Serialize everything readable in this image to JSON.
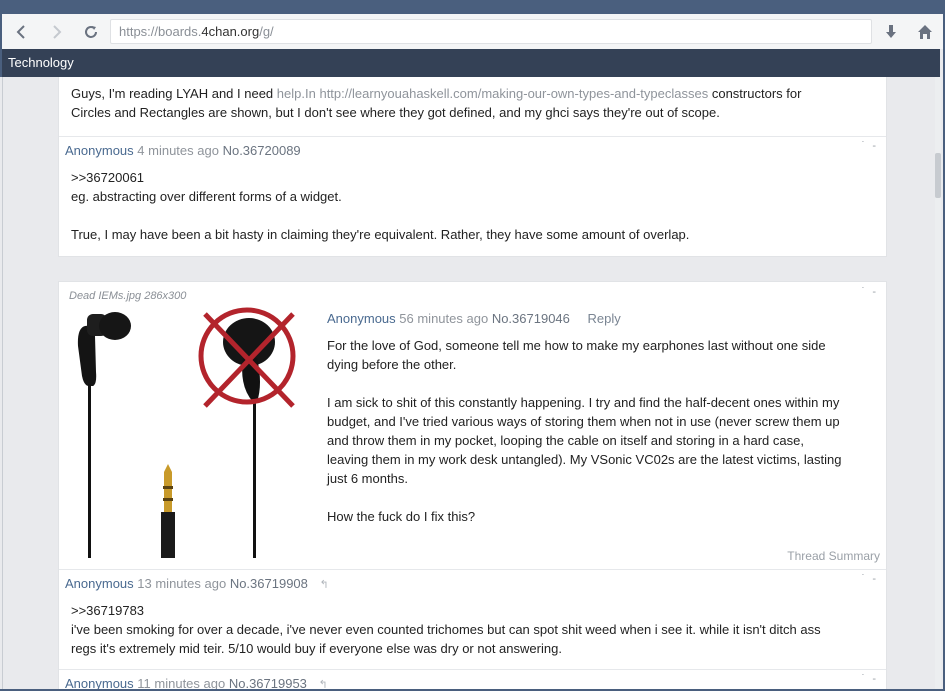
{
  "toolbar": {
    "back_icon": "chevron-left-icon",
    "forward_icon": "chevron-right-icon",
    "reload_icon": "reload-icon",
    "url_prefix": "https://boards.",
    "url_domain": "4chan.org",
    "url_suffix": "/g/",
    "download_icon": "download-icon",
    "home_icon": "home-icon"
  },
  "board": {
    "title": "Technology"
  },
  "thread_prev": {
    "op_text_a": "Guys, I'm reading LYAH and I need",
    "op_link_1": "help.In",
    "op_link_2": "http://learnyouahaskell.com/making-our-own-types-and-typeclasses",
    "op_text_b": "constructors for",
    "op_text_c": "Circles and Rectangles are shown, but I don't see where they got defined, and my ghci says they're out of scope.",
    "reply": {
      "name": "Anonymous",
      "time": "4 minutes ago",
      "number": "No.36720089",
      "quote": ">>36720061",
      "line1": "eg. abstracting over different forms of a widget.",
      "line2": "True, I may have been a bit hasty in claiming they're equivalent. Rather, they have some amount of overlap."
    }
  },
  "thread_main": {
    "file_info": "Dead IEMs.jpg 286x300",
    "name": "Anonymous",
    "time": "56 minutes ago",
    "number": "No.36719046",
    "reply_label": "Reply",
    "p1a": "For the love of God, someone tell me how to make my earphones last without one side",
    "p1b": "dying before the other.",
    "p2a": "I am sick to shit of this constantly happening. I try and find the half-decent ones within my",
    "p2b": "budget, and I've tried various ways of storing them when not in use (never screw them up",
    "p2c": "and throw them in my pocket, looping the cable on itself and storing in a hard case,",
    "p2d": "leaving them in my work desk untangled). My VSonic VC02s are the latest victims, lasting",
    "p2e": "just 6 months.",
    "p3": "How the fuck do I fix this?",
    "summary": "Thread Summary",
    "reply1": {
      "name": "Anonymous",
      "time": "13 minutes ago",
      "number": "No.36719908",
      "quote": ">>36719783",
      "line1": "i've been smoking for over a decade, i've never even counted trichomes but can spot shit weed when i see it. while it isn't ditch ass",
      "line2": "regs it's extremely mid teir. 5/10 would buy if everyone else was dry or not answering."
    },
    "reply2": {
      "name": "Anonymous",
      "time": "11 minutes ago",
      "number": "No.36719953"
    }
  },
  "colors": {
    "chrome": "#4a5f7e",
    "tabbar": "#344156",
    "name": "#4a6a90"
  }
}
